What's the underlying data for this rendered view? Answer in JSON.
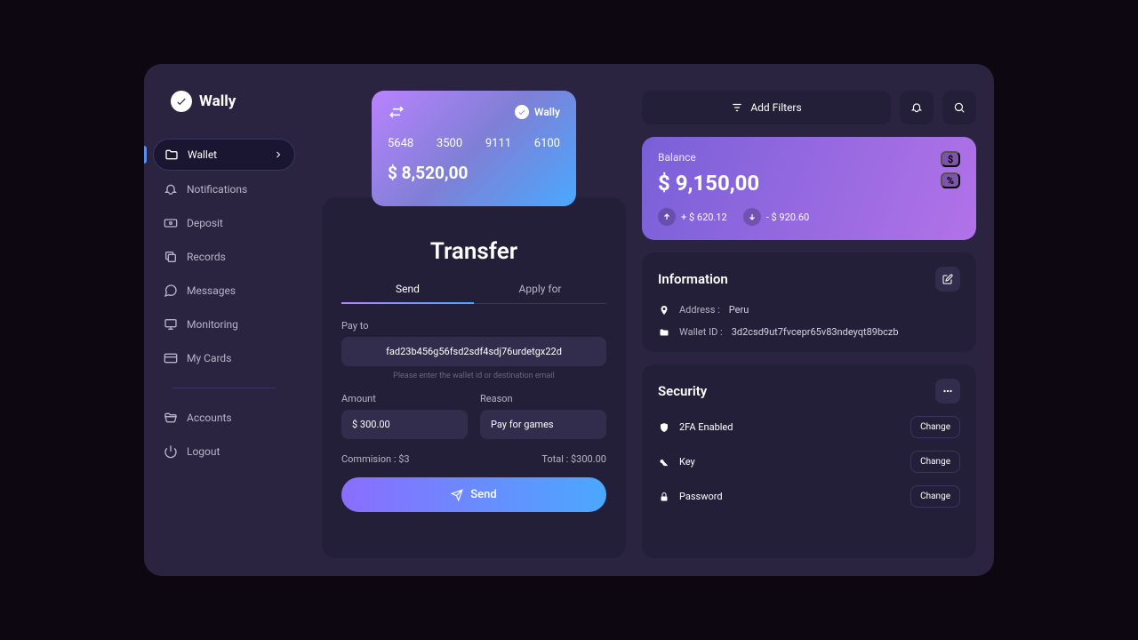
{
  "brand": {
    "name": "Wally"
  },
  "sidebar": {
    "items": [
      {
        "label": "Wallet",
        "active": true
      },
      {
        "label": "Notifications"
      },
      {
        "label": "Deposit"
      },
      {
        "label": "Records"
      },
      {
        "label": "Messages"
      },
      {
        "label": "Monitoring"
      },
      {
        "label": "My Cards"
      }
    ],
    "bottom": [
      {
        "label": "Accounts"
      },
      {
        "label": "Logout"
      }
    ]
  },
  "card": {
    "brand": "Wally",
    "numbers": [
      "5648",
      "3500",
      "9111",
      "6100"
    ],
    "balance": "$ 8,520,00"
  },
  "transfer": {
    "title": "Transfer",
    "tabs": {
      "send": "Send",
      "apply": "Apply for"
    },
    "payto_label": "Pay to",
    "payto_value": "fad23b456g56fsd2sdf4sdj76urdetgx22d",
    "payto_hint": "Please enter the wallet id or destination email",
    "amount_label": "Amount",
    "amount_value": "$ 300.00",
    "reason_label": "Reason",
    "reason_value": "Pay for games",
    "commission_label": "Commision : $3",
    "total_label": "Total : $300.00",
    "send_button": "Send"
  },
  "topbar": {
    "filters": "Add Filters"
  },
  "balance": {
    "label": "Balance",
    "amount": "$ 9,150,00",
    "inflow": "+ $ 620.12",
    "outflow": "- $ 920.60"
  },
  "information": {
    "title": "Information",
    "address_label": "Address :",
    "address_value": "Peru",
    "walletid_label": "Wallet ID :",
    "walletid_value": "3d2csd9ut7fvcepr65v83ndeyqt89bczb"
  },
  "security": {
    "title": "Security",
    "items": [
      {
        "label": "2FA Enabled"
      },
      {
        "label": "Key"
      },
      {
        "label": "Password"
      }
    ],
    "change": "Change"
  }
}
